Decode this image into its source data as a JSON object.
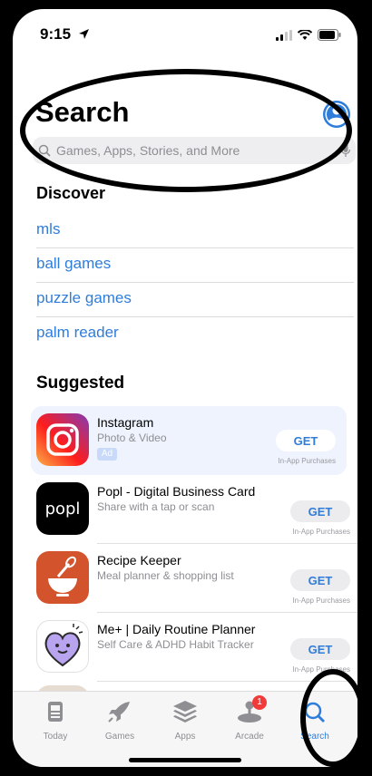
{
  "status_bar": {
    "time": "9:15"
  },
  "header": {
    "title": "Search",
    "account_icon": "person-circle-icon"
  },
  "search": {
    "placeholder": "Games, Apps, Stories, and More"
  },
  "discover": {
    "heading": "Discover",
    "items": [
      "mls",
      "ball games",
      "puzzle games",
      "palm reader"
    ]
  },
  "suggested": {
    "heading": "Suggested",
    "apps": [
      {
        "name": "Instagram",
        "subtitle": "Photo & Video",
        "ad_label": "Ad",
        "action": "GET",
        "note": "In-App Purchases"
      },
      {
        "name": "Popl - Digital Business Card",
        "subtitle": "Share with a tap or scan",
        "action": "GET",
        "note": "In-App Purchases",
        "icon_text": "popl"
      },
      {
        "name": "Recipe Keeper",
        "subtitle": "Meal planner & shopping list",
        "action": "GET",
        "note": "In-App Purchases"
      },
      {
        "name": "Me+ | Daily Routine Planner",
        "subtitle": "Self Care & ADHD Habit Tracker",
        "action": "GET",
        "note": "In-App Purchases"
      }
    ]
  },
  "tabbar": {
    "tabs": [
      {
        "label": "Today",
        "icon": "today-icon"
      },
      {
        "label": "Games",
        "icon": "rocket-icon"
      },
      {
        "label": "Apps",
        "icon": "apps-stack-icon"
      },
      {
        "label": "Arcade",
        "icon": "joystick-icon",
        "badge": "1"
      },
      {
        "label": "Search",
        "icon": "search-icon",
        "active": true
      }
    ]
  },
  "colors": {
    "accent": "#2f7ddb",
    "badge": "#f13b3b"
  }
}
